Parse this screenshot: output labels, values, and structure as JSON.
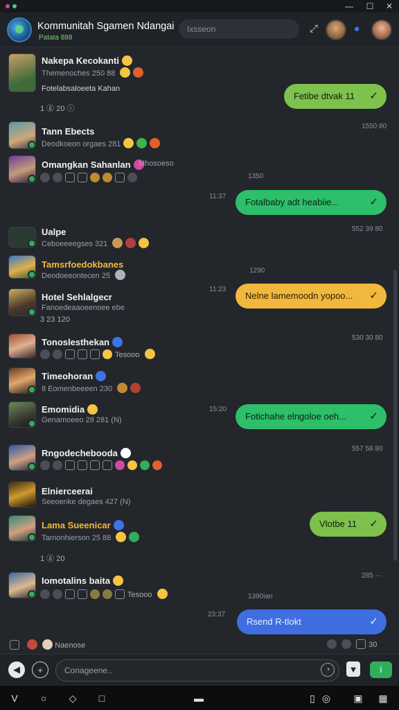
{
  "window": {
    "minimize": "—",
    "maximize": "☐",
    "close": "✕"
  },
  "header": {
    "title": "Kommunitah Sgamen Ndangai",
    "subtitle": "Patata 888",
    "search_placeholder": "Ixsseon"
  },
  "messages": [
    {
      "name": "Nakepa Kecokanti",
      "sub": "Themenoches 250 88",
      "sub2": "Fotelabsaloeeta Kahan",
      "reacts": "1 ⓖ 20 ⓘ"
    },
    {
      "name": "Tann Ebects",
      "sub": "Deodkoeon orgaes 281",
      "time": "1550 80"
    },
    {
      "name": "Omangkan Sahanlan",
      "sub": "Mhosoeso",
      "reacts": "1350"
    },
    {
      "name": "Ualpe",
      "sub": "Ceboeeeegses 321",
      "time": "552 39 80"
    },
    {
      "name": "Tamsrfoedokbanes",
      "sub": "Deodoeeontecen 25",
      "reacts": "1290"
    },
    {
      "name": "Hotel Sehlalgecr",
      "sub": "Fanoedeaaoeenoee  ebe",
      "reacts": "3 23 120"
    },
    {
      "name": "Tonoslesthekan",
      "sub": "Tesooo",
      "time": "530 30 80"
    },
    {
      "name": "Timeohoran",
      "sub": "8 Eomenbeeeen 230"
    },
    {
      "name": "Emomidia",
      "sub": "Genamoeeo 28 281 (N)"
    },
    {
      "name": "Rngodechebooda",
      "time": "557 58 80"
    },
    {
      "name": "Elnierceerai",
      "sub": "Seeoenke degaes 427 (N)"
    },
    {
      "name": "Lama Sueenicar",
      "sub": "Tarnonhierson 25 88",
      "reacts": "1 ⓖ 20"
    },
    {
      "name": "Iomotalins baita",
      "sub": "Tesooo",
      "reacts": "1390ian",
      "time": "285 ···"
    }
  ],
  "bubbles": [
    {
      "text": "Fetibe dtvak",
      "count": "11",
      "check": "✓"
    },
    {
      "text": "Fotalbaby adt  heabiie...",
      "time": "11:37",
      "check": "✓"
    },
    {
      "text": "Nelne lamemoodn yopoo...",
      "time": "11:23",
      "check": "✓"
    },
    {
      "text": "Fotichahe elngoloe oeh...",
      "time": "15:20",
      "check": "✓"
    },
    {
      "text": "Vlotbe",
      "count": "11",
      "check": "✓"
    },
    {
      "text": "Rsend R-tlokt",
      "time": "23:37",
      "check": "✓"
    }
  ],
  "footer_bar": {
    "label": "Naenose",
    "count": "30"
  },
  "composer": {
    "placeholder": "Conageene.."
  },
  "colors": {
    "accent_green": "#2dbf6a",
    "accent_lime": "#7ec14d",
    "accent_yellow": "#f0b83c",
    "accent_blue": "#3e6ee0"
  }
}
